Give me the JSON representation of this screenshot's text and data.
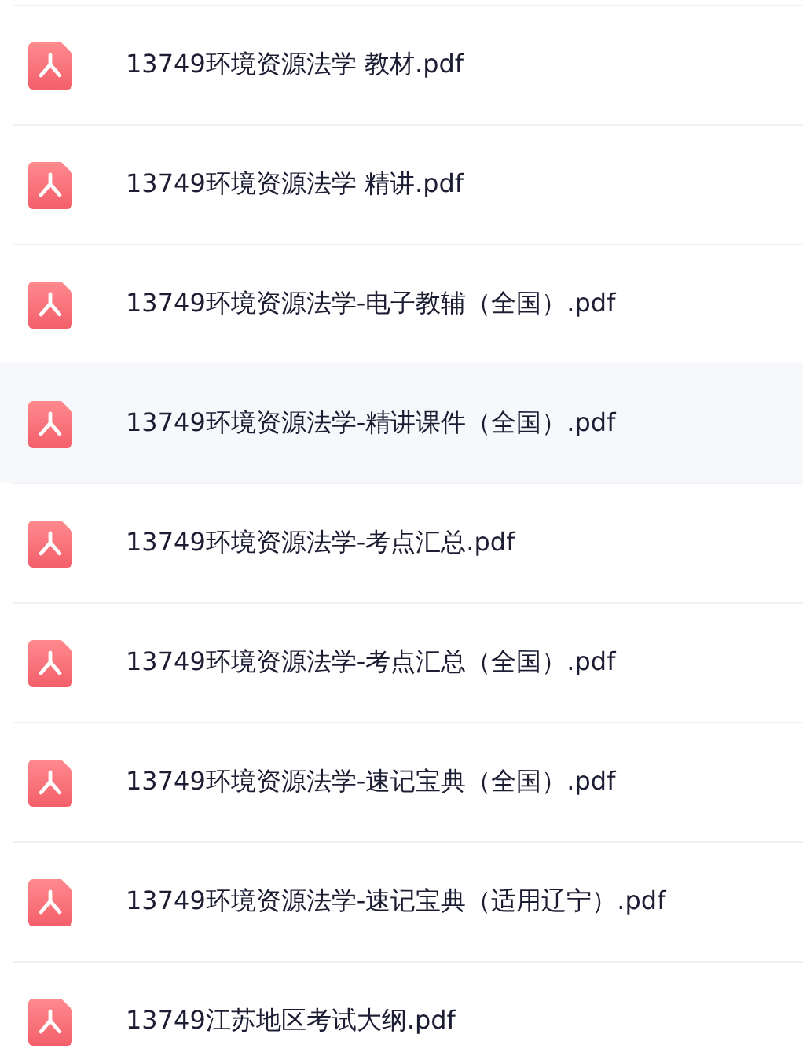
{
  "files": [
    {
      "name": "13749环境资源法学 教材.pdf",
      "selected": false
    },
    {
      "name": "13749环境资源法学 精讲.pdf",
      "selected": false
    },
    {
      "name": "13749环境资源法学-电子教辅（全国）.pdf",
      "selected": false
    },
    {
      "name": "13749环境资源法学-精讲课件（全国）.pdf",
      "selected": true
    },
    {
      "name": "13749环境资源法学-考点汇总.pdf",
      "selected": false
    },
    {
      "name": "13749环境资源法学-考点汇总（全国）.pdf",
      "selected": false
    },
    {
      "name": "13749环境资源法学-速记宝典（全国）.pdf",
      "selected": false
    },
    {
      "name": "13749环境资源法学-速记宝典（适用辽宁）.pdf",
      "selected": false
    },
    {
      "name": "13749江苏地区考试大纲.pdf",
      "selected": false
    }
  ]
}
